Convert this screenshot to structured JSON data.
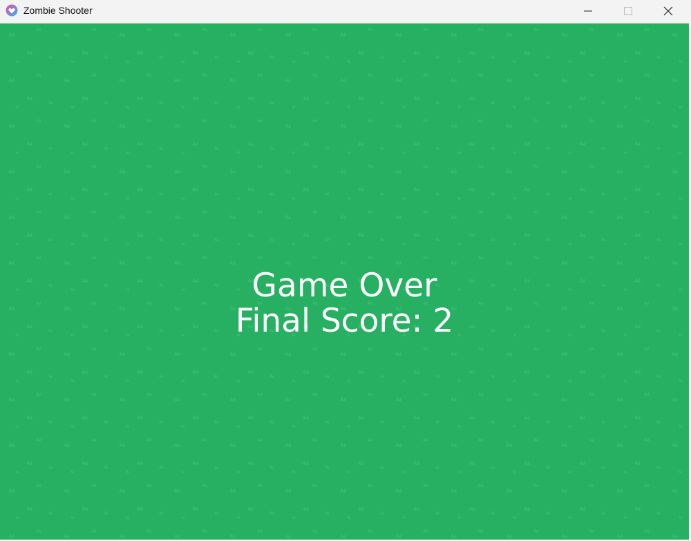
{
  "window": {
    "title": "Zombie Shooter",
    "icon": "app-heart-icon",
    "controls": [
      "minimize-icon",
      "maximize-icon",
      "close-icon"
    ]
  },
  "game": {
    "background_color": "#28b062",
    "grass_tuft_color": "#35be6e",
    "text_color": "#ffffff",
    "game_over_text": "Game Over",
    "final_score_label": "Final Score:",
    "final_score_value": 2,
    "final_score_text": "Final Score: 2"
  }
}
